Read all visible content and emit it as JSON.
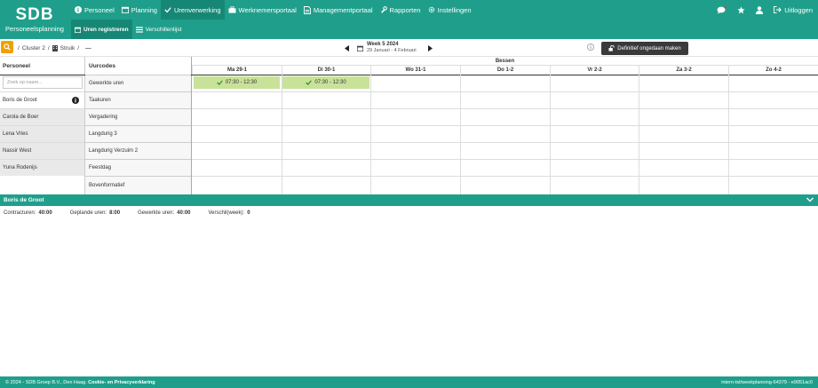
{
  "brand": {
    "logo": "SDB",
    "subtitle": "Personeelsplanning"
  },
  "nav": {
    "items": [
      {
        "label": "Personeel",
        "icon": "info-icon"
      },
      {
        "label": "Planning",
        "icon": "calendar-icon"
      },
      {
        "label": "Urenverwerking",
        "icon": "check-icon",
        "active": true
      },
      {
        "label": "Werknemersportaal",
        "icon": "briefcase-icon"
      },
      {
        "label": "Managementportaal",
        "icon": "document-icon"
      },
      {
        "label": "Rapporten",
        "icon": "wrench-icon"
      },
      {
        "label": "Instellingen",
        "icon": "gear-icon"
      }
    ],
    "logout": "Uitloggen"
  },
  "subnav": {
    "items": [
      {
        "label": "Uren registreren",
        "active": true
      },
      {
        "label": "Verschillenlijst"
      }
    ]
  },
  "toolbar": {
    "crumb_root": "/",
    "cluster": "Cluster 2",
    "sep1": "/",
    "location": "Struik",
    "sep2": "/",
    "dash": "—",
    "week_title": "Week 5 2024",
    "week_range": "29 Januari - 4 Februari",
    "undo_label": "Definitief ongedaan maken"
  },
  "table": {
    "col_personeel": "Personeel",
    "col_uurcodes": "Uurcodes",
    "group": "Bessen",
    "search_placeholder": "Zoek op naam...",
    "days": [
      "Ma 29-1",
      "Di 30-1",
      "Wo 31-1",
      "Do 1-2",
      "Vr 2-2",
      "Za 3-2",
      "Zo 4-2"
    ],
    "people": [
      "Boris de Groot",
      "Carola de Boer",
      "Lena Vries",
      "Nassir West",
      "Yuna Rodenijs"
    ],
    "codes": [
      "Gewerkte uren",
      "Taakuren",
      "Vergadering",
      "Langdurig 3",
      "Langdurig Verzuim 2",
      "Feestdag",
      "Bovenformatief"
    ],
    "entries": [
      {
        "label": "07:30 - 12:30"
      },
      {
        "label": "07:30 - 12:30"
      }
    ]
  },
  "summary": {
    "name": "Boris de Groot",
    "contract_label": "Contracturen:",
    "contract_value": "40:00",
    "planned_label": "Geplande uren:",
    "planned_value": "8:00",
    "worked_label": "Gewerkte uren:",
    "worked_value": "40:00",
    "diff_label": "Verschil(week):",
    "diff_value": "0"
  },
  "footer": {
    "left": "© 2024 - SDB Groep B.V., Den Haag.",
    "link": "Cookie- en Privacyverklaring",
    "right": "intern-tst/weekplanning-64379 - e9051ac0"
  },
  "colors": {
    "primary": "#1f9f8b",
    "accent": "#f0a000",
    "entry": "#c8e29a"
  }
}
